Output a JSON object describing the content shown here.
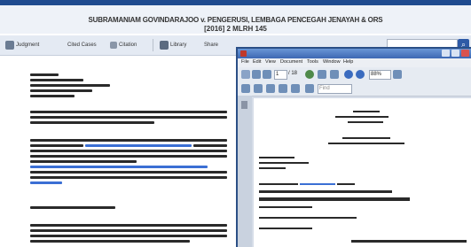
{
  "header": {
    "title_line1": "SUBRAMANIAM GOVINDARAJOO v. PENGERUSI, LEMBAGA PENCEGAH JENAYAH & ORS",
    "title_line2": "[2016] 2 MLRH 145"
  },
  "toolbar": {
    "items": [
      "Judgment",
      "Cited Cases",
      "Citation",
      "Library",
      "Share"
    ]
  },
  "pdf_viewer": {
    "menu": [
      "File",
      "Edit",
      "View",
      "Document",
      "Tools",
      "Window",
      "Help"
    ],
    "page_number": "1",
    "page_total": "/ 18",
    "zoom": "88%",
    "find_placeholder": "Find"
  },
  "colors": {
    "brand_blue": "#1f4b8f",
    "link_blue": "#3b6fd4"
  }
}
